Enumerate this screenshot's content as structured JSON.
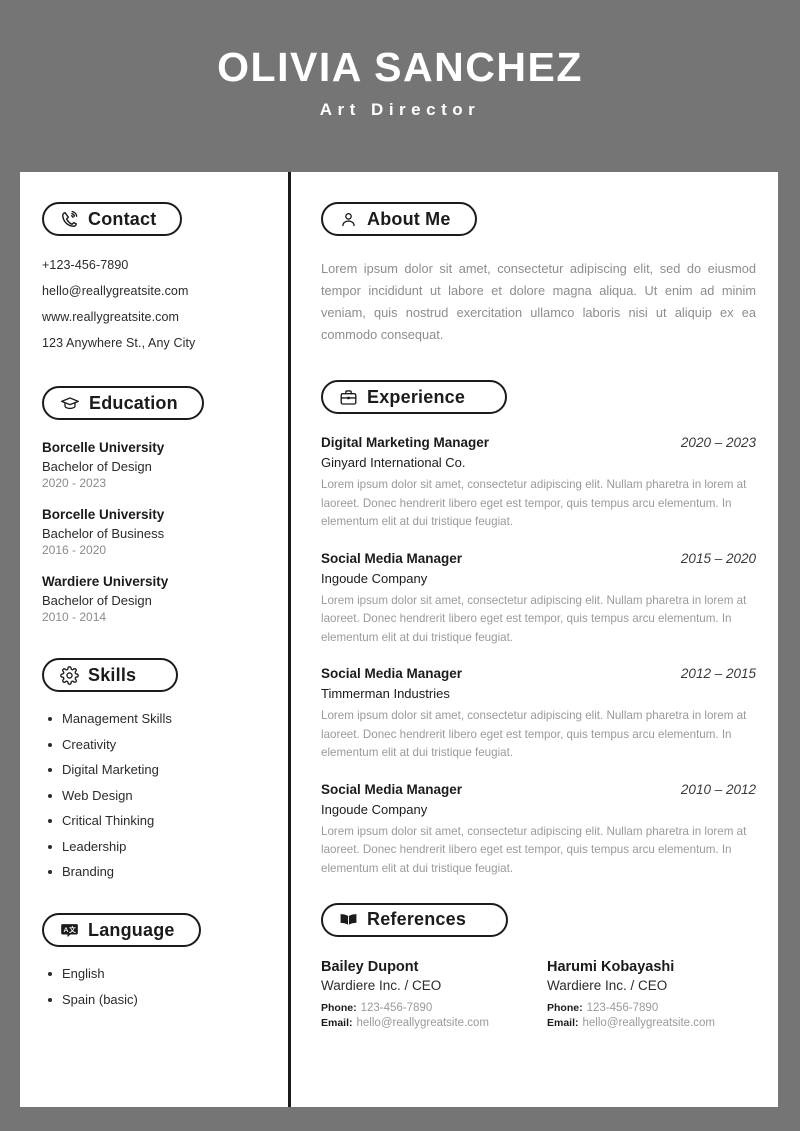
{
  "header": {
    "name": "OLIVIA SANCHEZ",
    "role": "Art Director",
    "bg_color": "#757575",
    "text_color": "#FFFFFF"
  },
  "left_column": {
    "contact": {
      "title": "Contact",
      "icon": "phone-icon",
      "items": [
        "+123-456-7890",
        "hello@reallygreatsite.com",
        "www.reallygreatsite.com",
        "123 Anywhere St., Any City"
      ]
    },
    "education": {
      "title": "Education",
      "icon": "graduation-cap-icon",
      "items": [
        {
          "school": "Borcelle University",
          "degree": "Bachelor of Design",
          "years": "2020 - 2023"
        },
        {
          "school": "Borcelle University",
          "degree": "Bachelor of Business",
          "years": "2016 - 2020"
        },
        {
          "school": "Wardiere University",
          "degree": "Bachelor of Design",
          "years": "2010 - 2014"
        }
      ]
    },
    "skills": {
      "title": "Skills",
      "icon": "gear-icon",
      "items": [
        "Management Skills",
        "Creativity",
        "Digital Marketing",
        "Web Design",
        "Critical Thinking",
        "Leadership",
        "Branding"
      ]
    },
    "language": {
      "title": "Language",
      "icon": "translate-icon",
      "items": [
        "English",
        "Spain (basic)"
      ]
    }
  },
  "right_column": {
    "about": {
      "title": "About Me",
      "icon": "person-icon",
      "text": "Lorem ipsum dolor sit amet, consectetur adipiscing elit, sed do eiusmod tempor incididunt ut labore et dolore magna aliqua. Ut enim ad minim veniam, quis nostrud exercitation ullamco laboris nisi ut aliquip ex ea commodo consequat."
    },
    "experience": {
      "title": "Experience",
      "icon": "briefcase-icon",
      "items": [
        {
          "role": "Digital Marketing Manager",
          "years": "2020 – 2023",
          "company": "Ginyard International Co.",
          "desc": "Lorem ipsum dolor sit amet, consectetur adipiscing elit. Nullam pharetra in lorem at laoreet. Donec hendrerit libero eget est tempor, quis tempus arcu elementum. In elementum elit at dui tristique feugiat."
        },
        {
          "role": "Social Media Manager",
          "years": "2015 – 2020",
          "company": "Ingoude Company",
          "desc": "Lorem ipsum dolor sit amet, consectetur adipiscing elit. Nullam pharetra in lorem at laoreet. Donec hendrerit libero eget est tempor, quis tempus arcu elementum. In elementum elit at dui tristique feugiat."
        },
        {
          "role": "Social Media Manager",
          "years": "2012 – 2015",
          "company": "Timmerman Industries",
          "desc": "Lorem ipsum dolor sit amet, consectetur adipiscing elit. Nullam pharetra in lorem at laoreet. Donec hendrerit libero eget est tempor, quis tempus arcu elementum. In elementum elit at dui tristique feugiat."
        },
        {
          "role": "Social Media Manager",
          "years": "2010 – 2012",
          "company": "Ingoude Company",
          "desc": "Lorem ipsum dolor sit amet, consectetur adipiscing elit. Nullam pharetra in lorem at laoreet. Donec hendrerit libero eget est tempor, quis tempus arcu elementum. In elementum elit at dui tristique feugiat."
        }
      ]
    },
    "references": {
      "title": "References",
      "icon": "open-book-icon",
      "phone_label": "Phone:",
      "email_label": "Email:",
      "items": [
        {
          "name": "Bailey Dupont",
          "title": "Wardiere Inc. / CEO",
          "phone": "123-456-7890",
          "email": "hello@reallygreatsite.com"
        },
        {
          "name": "Harumi Kobayashi",
          "title": "Wardiere Inc. / CEO",
          "phone": "123-456-7890",
          "email": "hello@reallygreatsite.com"
        }
      ]
    }
  }
}
